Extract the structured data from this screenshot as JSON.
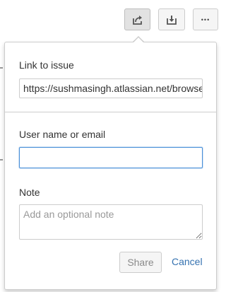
{
  "toolbar": {
    "share_icon": "share-icon",
    "export_icon": "download-icon",
    "more_icon": "ellipsis-icon",
    "more_glyph": "•••"
  },
  "share_dialog": {
    "link_label": "Link to issue",
    "link_value": "https://sushmasingh.atlassian.net/browse/",
    "user_label": "User name or email",
    "user_value": "",
    "note_label": "Note",
    "note_placeholder": "Add an optional note",
    "share_button": "Share",
    "cancel_link": "Cancel"
  },
  "colors": {
    "accent": "#3572b0",
    "focus_border": "#4a90d9",
    "border": "#cccccc"
  }
}
